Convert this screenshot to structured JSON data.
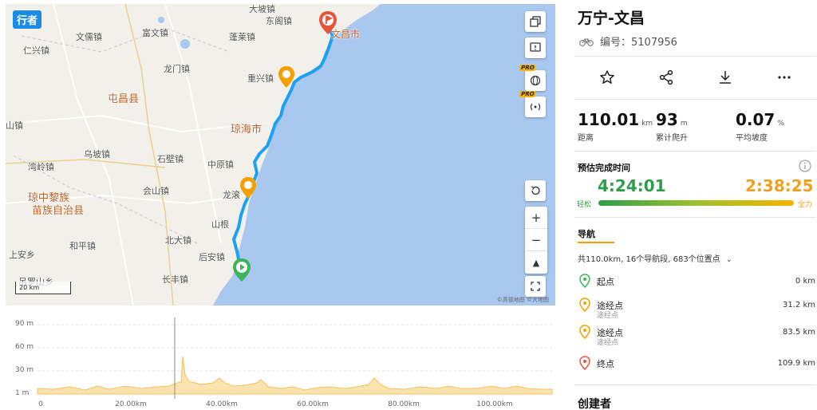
{
  "map": {
    "brand": "行者",
    "labels": {
      "dashan": "大坡镇",
      "dongge": "东阁镇",
      "wenru": "文儒镇",
      "fuwen": "富文镇",
      "penglai": "蓬莱镇",
      "renxing": "仁兴镇",
      "longmen": "龙门镇",
      "chongxing": "重兴镇",
      "tunchang": "屯昌县",
      "qionghai": "琼海市",
      "shanzhen": "山镇",
      "wupo": "乌坡镇",
      "shibi": "石壁镇",
      "zhongyuan": "中原镇",
      "wanling": "湾岭镇",
      "qiongzhong": "琼中黎族",
      "qiongzhong2": "苗族自治县",
      "huishan": "会山镇",
      "longgun": "龙滚",
      "shangen": "山根",
      "heping": "和平镇",
      "beida": "北大镇",
      "houan": "后安镇",
      "shangan": "上安乡",
      "changfeng": "长丰镇",
      "diaoluo": "吊罗山乡",
      "wenchang": "文昌市"
    },
    "scale_label": "20 km",
    "attribution": "©高德地图 ©大地图",
    "pro_badge": "PRO"
  },
  "elevation": {
    "y_ticks": [
      "90 m",
      "60 m",
      "30 m",
      "1 m"
    ],
    "x_ticks": [
      "0",
      "20.00km",
      "40.00km",
      "60.00km",
      "80.00km",
      "100.00km"
    ]
  },
  "route": {
    "title": "万宁-文昌",
    "number": "编号：5107956"
  },
  "stats": {
    "distance": {
      "value": "110.01",
      "unit": "km",
      "label": "距离"
    },
    "climb": {
      "value": "93",
      "unit": "m",
      "label": "累计爬升"
    },
    "grade": {
      "value": "0.07",
      "unit": "%",
      "label": "平均坡度"
    }
  },
  "estimate": {
    "title": "预估完成时间",
    "easy_time": "4:24:01",
    "hard_time": "2:38:25",
    "easy_label": "轻松",
    "hard_label": "全力"
  },
  "navigation": {
    "title": "导航",
    "summary": "共110.0km, 16个导航段, 683个位置点",
    "waypoints": [
      {
        "name": "起点",
        "sub": "",
        "dist": "0 km"
      },
      {
        "name": "途经点",
        "sub": "途经点",
        "dist": "31.2 km"
      },
      {
        "name": "途经点",
        "sub": "途经点",
        "dist": "83.5 km"
      },
      {
        "name": "终点",
        "sub": "",
        "dist": "109.9 km"
      }
    ]
  },
  "creator_title": "创建者",
  "colors": {
    "route": "#1ea1f0",
    "sea": "#a9c8f0",
    "easy": "#2e9e4a",
    "hard": "#f0a020",
    "start_pin": "#3cb55a",
    "mid_pin": "#f4a000",
    "end_pin": "#e8553e"
  }
}
